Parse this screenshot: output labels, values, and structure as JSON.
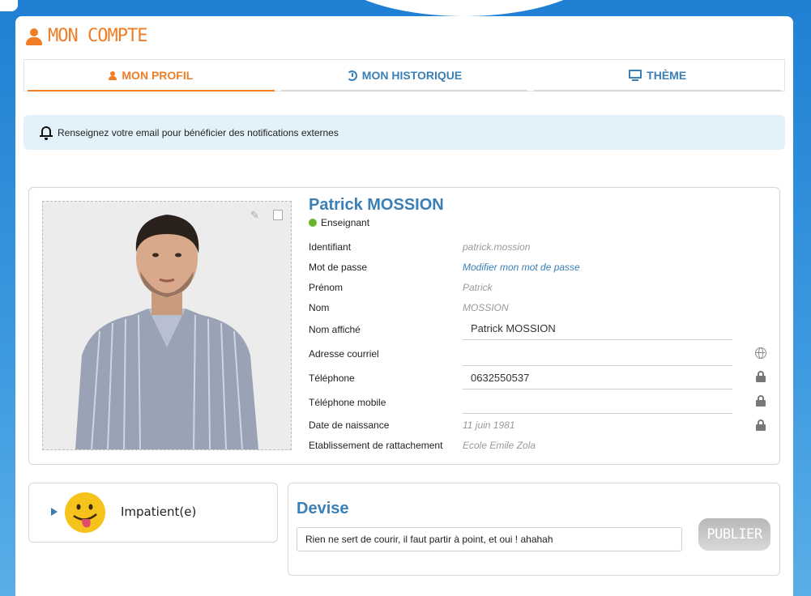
{
  "page": {
    "title": "MON COMPTE"
  },
  "tabs": [
    {
      "label": "MON PROFIL",
      "icon": "user-icon",
      "active": true
    },
    {
      "label": "MON HISTORIQUE",
      "icon": "history-icon",
      "active": false
    },
    {
      "label": "THÈME",
      "icon": "monitor-icon",
      "active": false
    }
  ],
  "notice": {
    "text": "Renseignez votre email pour bénéficier des notifications externes",
    "icon": "bell-icon"
  },
  "profile": {
    "name": "Patrick MOSSION",
    "role": "Enseignant",
    "role_status_color": "#6ab42d",
    "fields": [
      {
        "label": "Identifiant",
        "value": "patrick.mossion"
      },
      {
        "label": "Mot de passe",
        "value": "Modifier mon mot de passe"
      },
      {
        "label": "Prénom",
        "value": "Patrick"
      },
      {
        "label": "Nom",
        "value": "MOSSION"
      },
      {
        "label": "Nom affiché",
        "value": "Patrick MOSSION"
      },
      {
        "label": "Adresse courriel",
        "value": ""
      },
      {
        "label": "Téléphone",
        "value": "0632550537"
      },
      {
        "label": "Téléphone mobile",
        "value": ""
      },
      {
        "label": "Date de naissance",
        "value": "11 juin 1981"
      },
      {
        "label": "Etablissement de rattachement",
        "value": "Ecole Emile Zola"
      }
    ]
  },
  "mood": {
    "label": "Impatient(e)",
    "icon": "tongue-smiley-icon"
  },
  "devise": {
    "title": "Devise",
    "value": "Rien ne sert de courir, il faut partir à point, et oui ! ahahah",
    "publish_label": "PUBLIER"
  },
  "colors": {
    "accent": "#f07e26",
    "primary": "#3a7fb6",
    "background": "#2a8ad6"
  }
}
